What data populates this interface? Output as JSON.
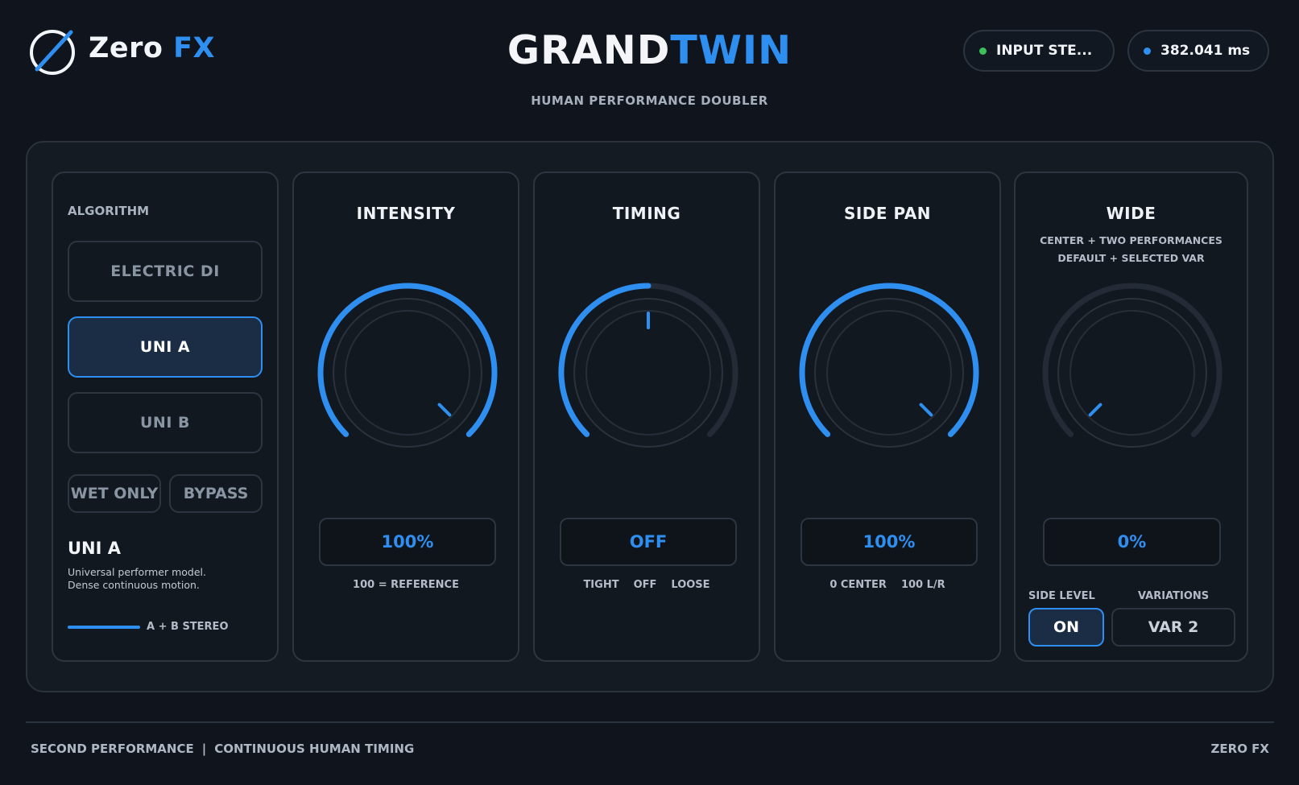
{
  "brand": {
    "name_part1": "Zero",
    "name_part2": "FX"
  },
  "header": {
    "title_part1": "GRAND",
    "title_part2": "TWIN",
    "subtitle": "HUMAN PERFORMANCE DOUBLER",
    "input_status": {
      "label": "INPUT  STE...",
      "dot_color": "#3cc05a"
    },
    "latency": {
      "label": "382.041 ms",
      "dot_color": "#2f8ff0"
    }
  },
  "algorithm": {
    "label": "ALGORITHM",
    "options": [
      "ELECTRIC DI",
      "UNI A",
      "UNI B"
    ],
    "selected": "UNI A",
    "wet_only_label": "WET ONLY",
    "bypass_label": "BYPASS",
    "current_name": "UNI A",
    "description_line1": "Universal performer model.",
    "description_line2": "Dense continuous motion.",
    "stereo_label": "A + B STEREO"
  },
  "knobs": {
    "intensity": {
      "title": "INTENSITY",
      "value": "100%",
      "fraction": 1.0,
      "caption": "100 = REFERENCE"
    },
    "timing": {
      "title": "TIMING",
      "value": "OFF",
      "fraction": 0.5,
      "caption_left": "TIGHT",
      "caption_mid": "OFF",
      "caption_right": "LOOSE"
    },
    "side_pan": {
      "title": "SIDE PAN",
      "value": "100%",
      "fraction": 1.0,
      "caption_left": "0 CENTER",
      "caption_right": "100 L/R"
    },
    "wide": {
      "title": "WIDE",
      "value": "0%",
      "fraction": 0.0,
      "sub_line1": "CENTER + TWO PERFORMANCES",
      "sub_line2": "DEFAULT + SELECTED VAR",
      "side_level_label": "SIDE LEVEL",
      "side_level_value": "ON",
      "variations_label": "VARIATIONS",
      "variations_value": "VAR 2"
    }
  },
  "footer": {
    "left_part1": "SECOND PERFORMANCE",
    "separator": "|",
    "left_part2": "CONTINUOUS HUMAN TIMING",
    "right": "ZERO FX"
  },
  "colors": {
    "accent": "#2f8ff0",
    "track": "#222b36",
    "background": "#10151d"
  }
}
